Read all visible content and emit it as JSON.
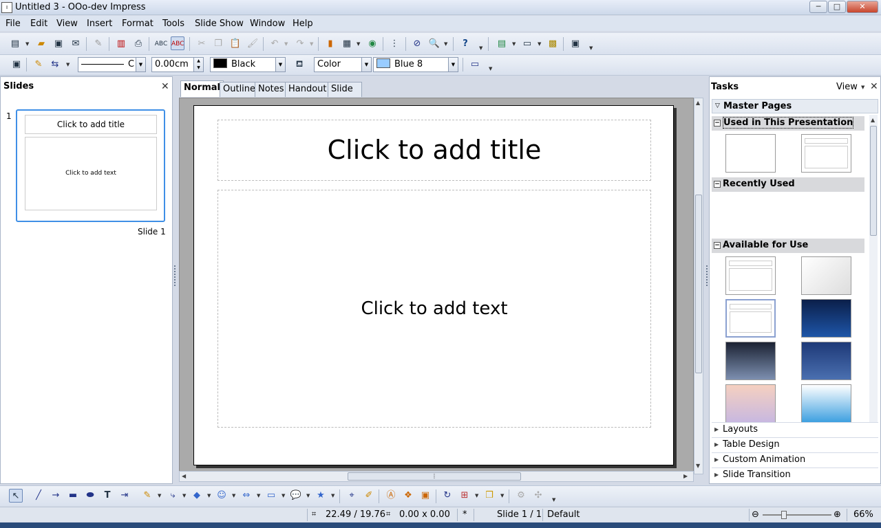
{
  "window": {
    "title": "Untitled 3 - OOo-dev Impress",
    "app_icon_label": "I",
    "minimize": "─",
    "maximize": "□",
    "close": "✕"
  },
  "menu": [
    "File",
    "Edit",
    "View",
    "Insert",
    "Format",
    "Tools",
    "Slide Show",
    "Window",
    "Help"
  ],
  "line_toolbar": {
    "line_width": "0.00cm",
    "line_color": "Black",
    "line_color_hex": "#000000",
    "area_style": "Color",
    "area_color": "Blue 8",
    "area_color_hex": "#99ccff",
    "line_style_suffix": "C"
  },
  "slides_pane": {
    "title": "Slides",
    "close": "✕",
    "slide_number": "1",
    "thumb_title": "Click to add title",
    "thumb_text": "Click to add text",
    "caption": "Slide 1"
  },
  "view_tabs": [
    "Normal",
    "Outline",
    "Notes",
    "Handout",
    "Slide Sorter"
  ],
  "active_tab": "Normal",
  "slide": {
    "title_placeholder": "Click to add title",
    "text_placeholder": "Click to add text"
  },
  "tasks_pane": {
    "title": "Tasks",
    "view_label": "View",
    "close": "✕",
    "master_pages_title": "Master Pages",
    "used_section": "Used in This Presentation",
    "recent_section": "Recently Used",
    "available_section": "Available for Use",
    "decks": [
      "Layouts",
      "Table Design",
      "Custom Animation",
      "Slide Transition"
    ]
  },
  "status": {
    "position": "22.49 / 19.76",
    "size": "0.00 x 0.00",
    "modified": "*",
    "slide": "Slide 1 / 1",
    "master": "Default",
    "zoom": "66%",
    "zoom_level": 0.66
  }
}
